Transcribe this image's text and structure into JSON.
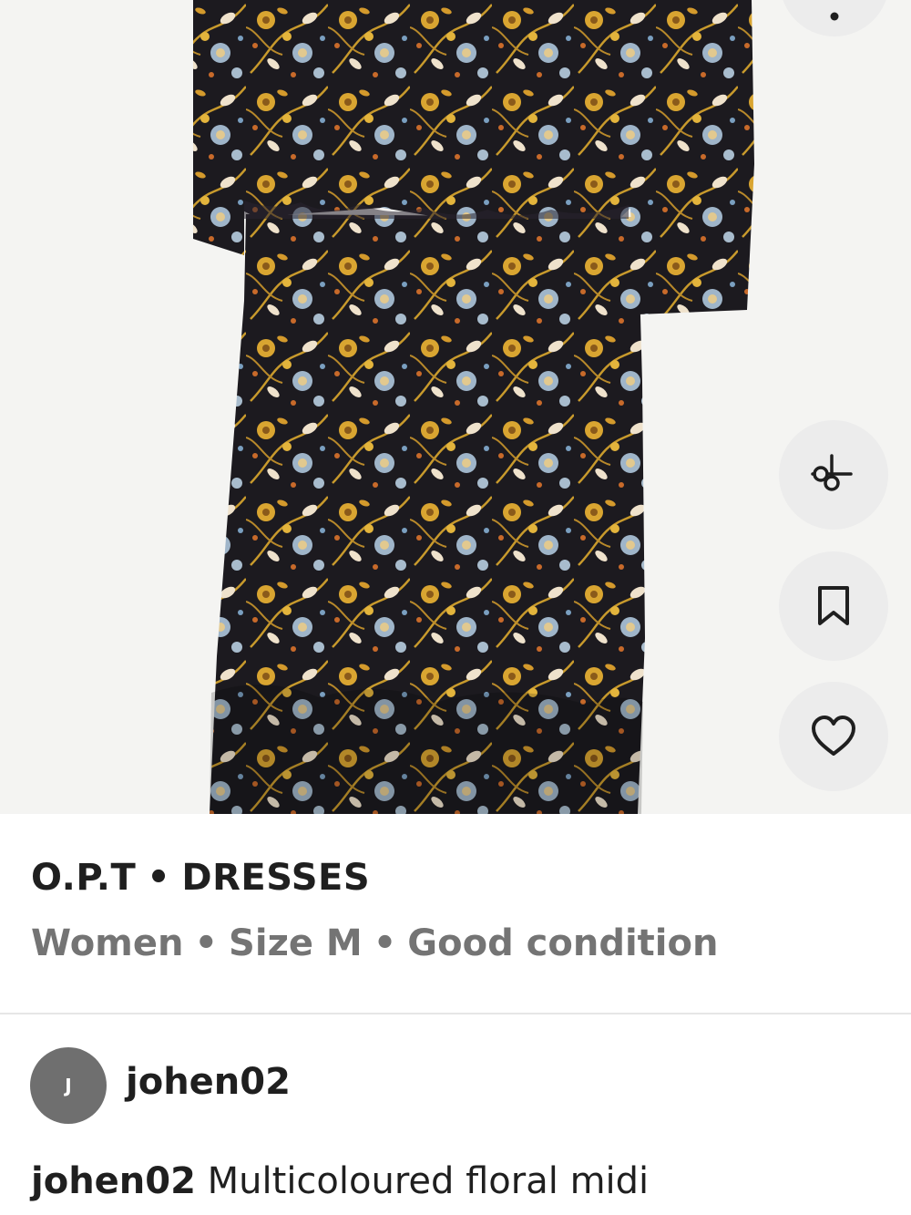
{
  "product": {
    "image_alt": "Multicoloured floral midi dress",
    "brand": "O.P.T",
    "category": "DRESSES",
    "separator": "•",
    "department": "Women",
    "size": "Size M",
    "condition": "Good condition"
  },
  "actions": {
    "menu_icon": "more-icon",
    "share_icon": "share-icon",
    "save_icon": "bookmark-icon",
    "like_icon": "heart-icon"
  },
  "seller": {
    "avatar_initial": "J",
    "username": "johen02"
  },
  "description": {
    "username": "johen02",
    "text": "Multicoloured floral midi"
  },
  "colors": {
    "button_bg": "#ececec",
    "avatar_bg": "#6f6f6f",
    "muted_text": "#747474",
    "dress_base": "#1c1a1f",
    "flower_gold": "#d9a531",
    "flower_blue": "#9fb5c9",
    "flower_cream": "#efe2cc"
  }
}
